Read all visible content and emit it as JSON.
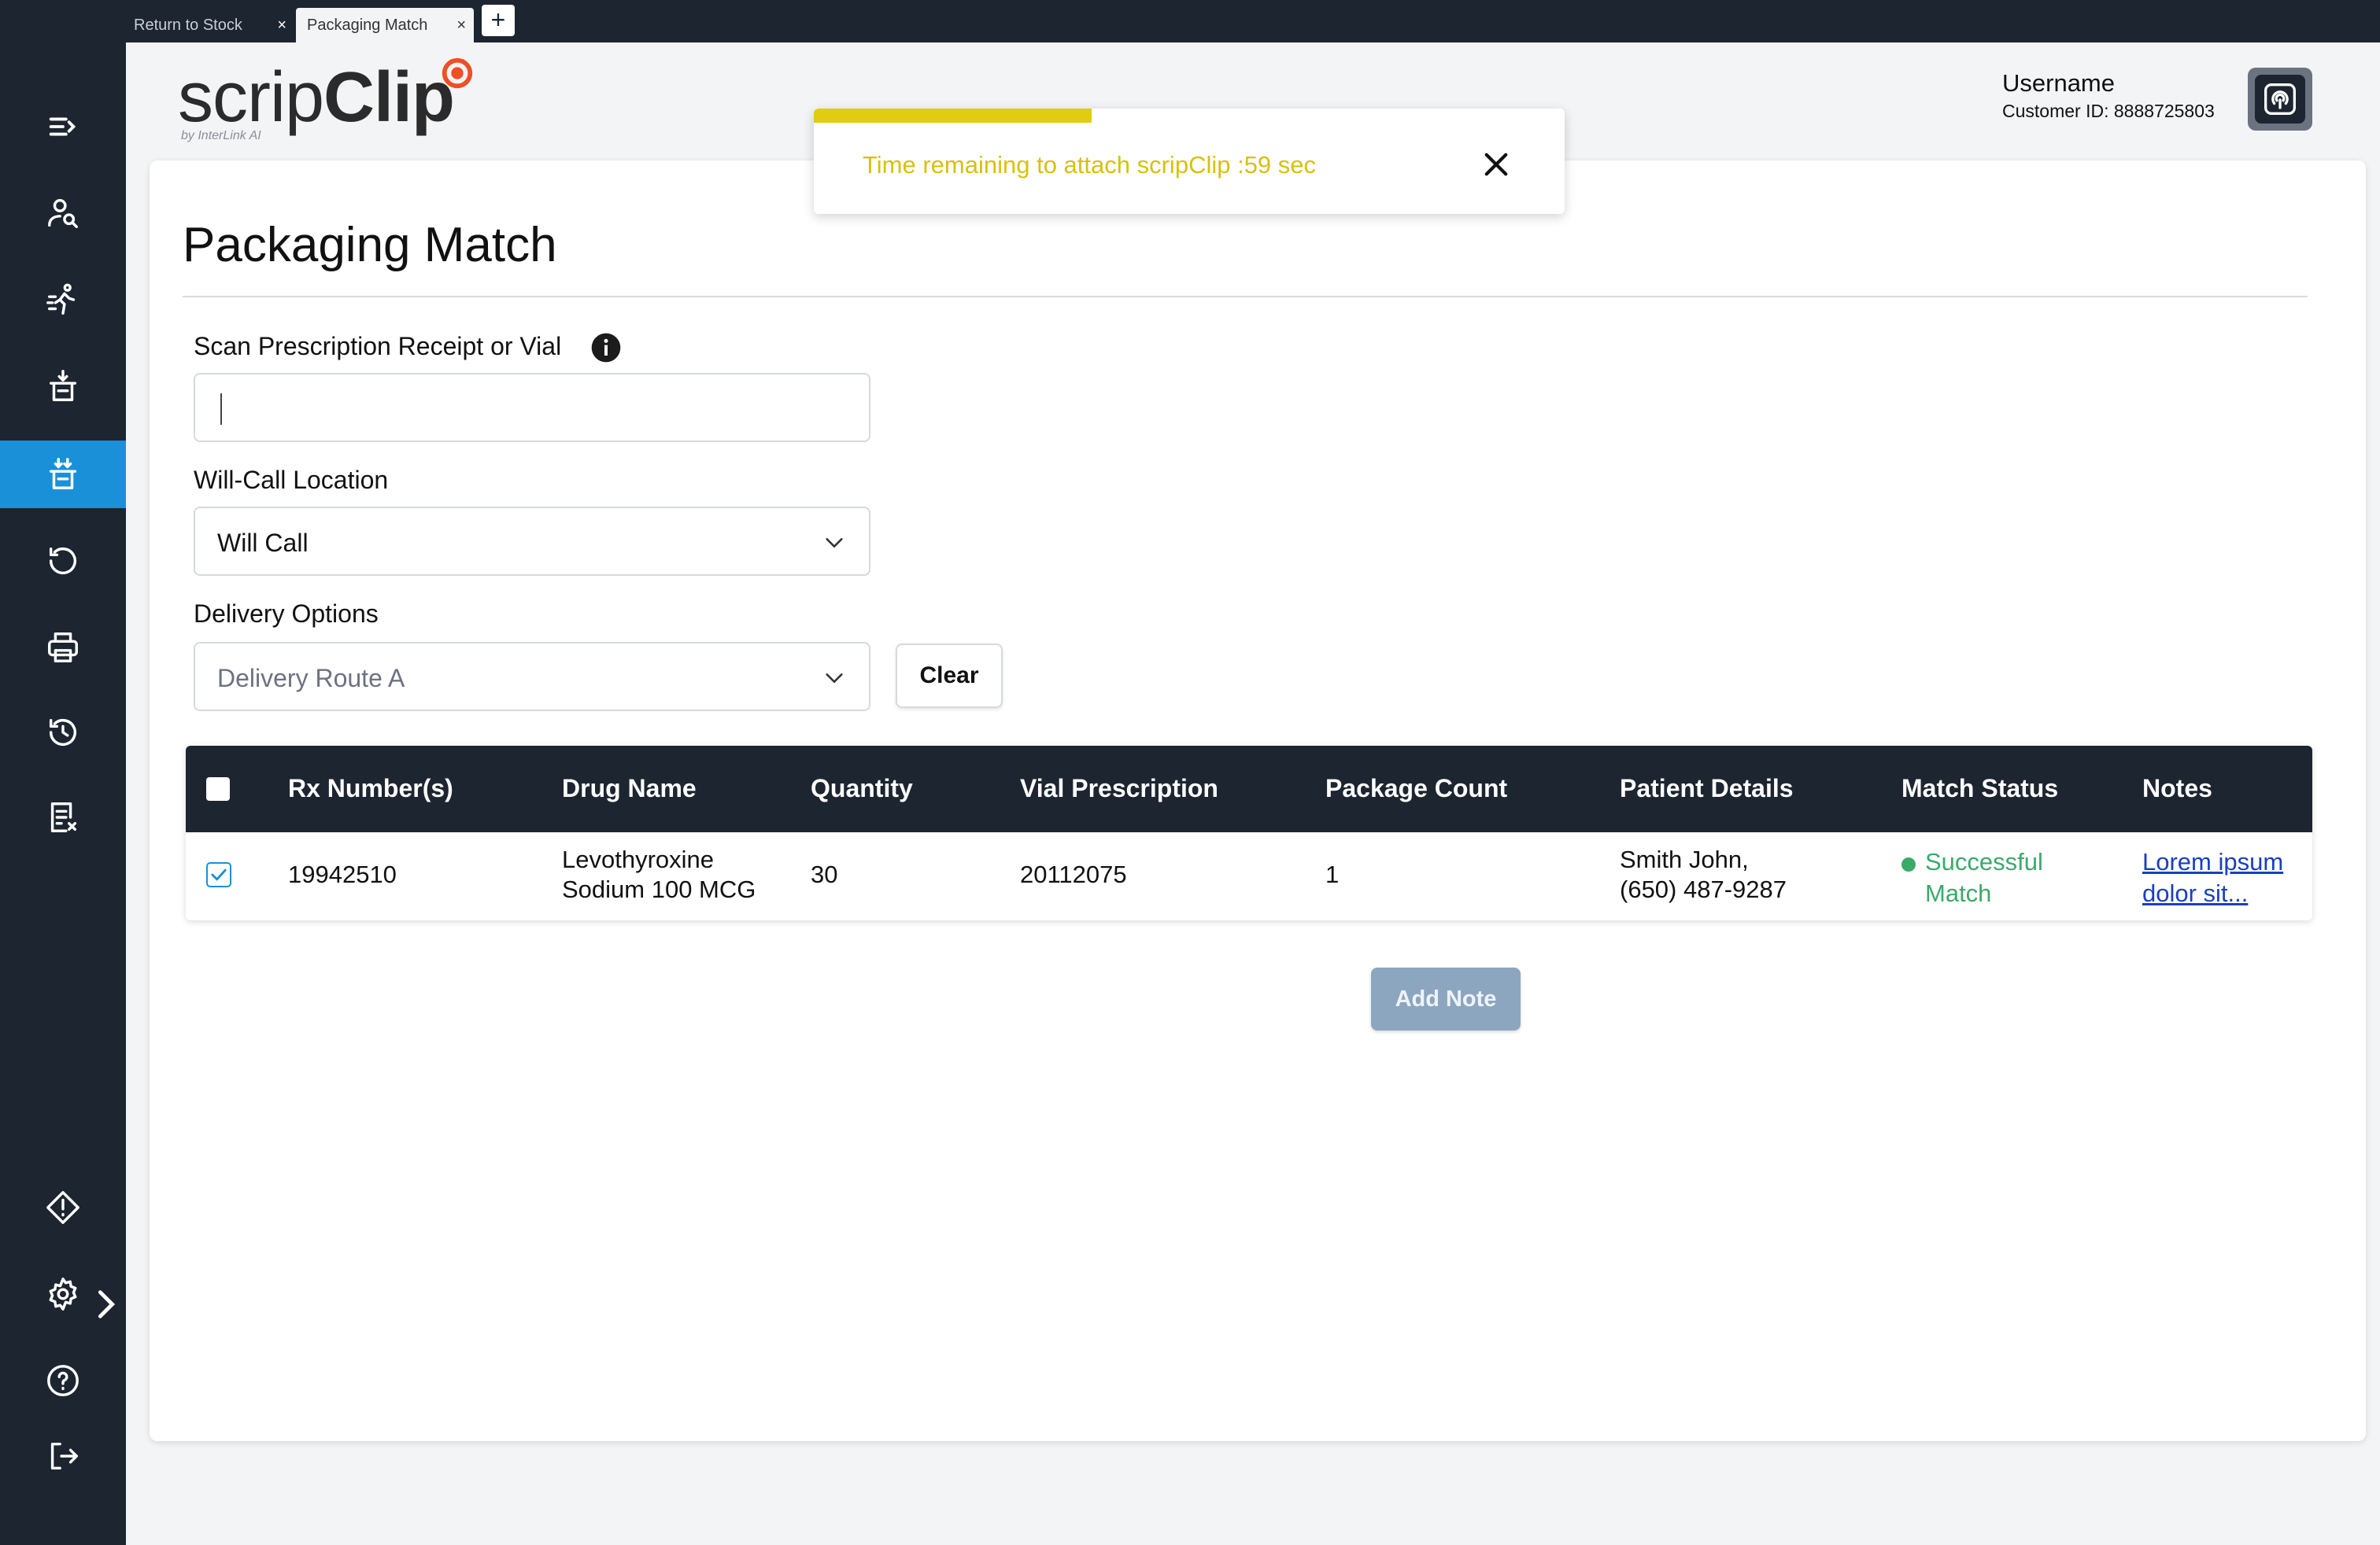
{
  "tabs": [
    {
      "label": "Return to Stock",
      "close": "×"
    },
    {
      "label": "Packaging Match",
      "close": "×"
    }
  ],
  "new_tab_label": "+",
  "sidebar": {
    "items": [
      {
        "icon": "menu-expand-icon"
      },
      {
        "icon": "user-search-icon"
      },
      {
        "icon": "running-person-icon"
      },
      {
        "icon": "basket-download-icon"
      },
      {
        "icon": "basket-double-download-icon",
        "active": true
      },
      {
        "icon": "undo-icon"
      },
      {
        "icon": "printer-icon"
      },
      {
        "icon": "history-icon"
      },
      {
        "icon": "receipt-cancel-icon"
      },
      {
        "icon": "warning-diamond-icon"
      },
      {
        "icon": "gear-icon"
      },
      {
        "icon": "help-icon"
      },
      {
        "icon": "logout-icon"
      }
    ],
    "active_color": "#1a90d8"
  },
  "logo": {
    "light": "scrip",
    "bold": "Clip",
    "byline": "by InterLink AI"
  },
  "user": {
    "name": "Username",
    "customer_id": "Customer ID: 8888725803"
  },
  "toast": {
    "message": "Time remaining to attach scripClip :59 sec",
    "progress_fraction": 0.37,
    "color": "#d8c010"
  },
  "page": {
    "title": "Packaging Match",
    "scan_label": "Scan Prescription Receipt or Vial",
    "scan_value": "",
    "willcall_label": "Will-Call Location",
    "willcall_value": "Will Call",
    "delivery_label": "Delivery Options",
    "delivery_value": "Delivery Route A",
    "clear_label": "Clear",
    "add_note_label": "Add Note"
  },
  "table": {
    "headers": [
      "Rx Number(s)",
      "Drug Name",
      "Quantity",
      "Vial Prescription",
      "Package Count",
      "Patient Details",
      "Match Status",
      "Notes"
    ],
    "rows": [
      {
        "rx": "19942510",
        "drug_line1": "Levothyroxine",
        "drug_line2": "Sodium 100 MCG",
        "quantity": "30",
        "vial": "20112075",
        "package_count": "1",
        "patient_line1": "Smith John,",
        "patient_line2": "(650) 487-9287",
        "status_line1": "Successful",
        "status_line2": "Match",
        "notes_line1": "Lorem ipsum",
        "notes_line2": "dolor sit...",
        "checked": true
      }
    ],
    "status_color": "#3aaa6a"
  }
}
